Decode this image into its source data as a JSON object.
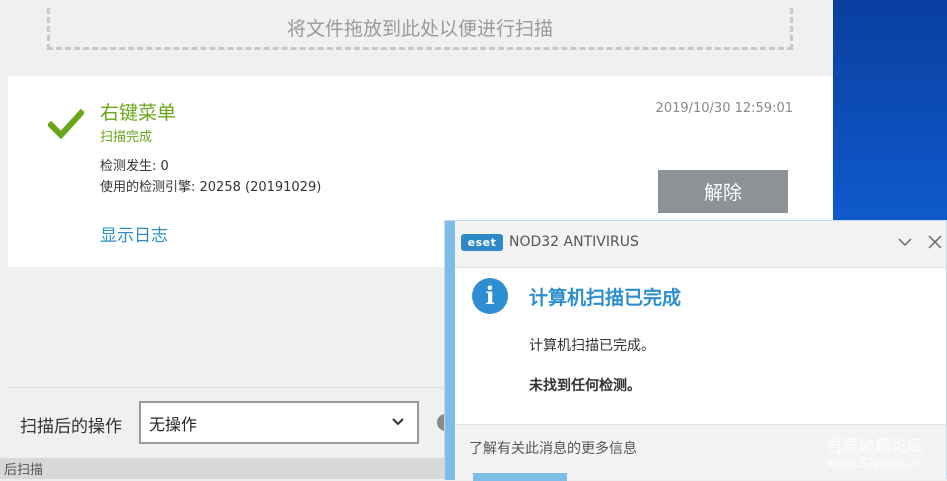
{
  "drop_zone": {
    "text": "将文件拖放到此处以便进行扫描"
  },
  "scan_result": {
    "title": "右键菜单",
    "status": "扫描完成",
    "detections": "检测发生: 0",
    "engine": "使用的检测引擎: 20258 (20191029)",
    "datetime": "2019/10/30 12:59:01",
    "show_log": "显示日志",
    "remove_button": "解除"
  },
  "after_scan": {
    "label": "扫描后的操作",
    "selected": "无操作"
  },
  "bottom_bar": {
    "text": "后扫描"
  },
  "popup": {
    "brand": "eset",
    "app_name": "NOD32 ANTIVIRUS",
    "title": "计算机扫描已完成",
    "message": "计算机扫描已完成。",
    "detail": "未找到任何检测。",
    "more_info": "了解有关此消息的更多信息"
  },
  "watermark": {
    "line1": "吾爱破解论坛",
    "line2": "www.52pojie.cn"
  },
  "colors": {
    "success": "#6aa619",
    "link": "#2a8fc7",
    "accent": "#2e8fd0"
  }
}
